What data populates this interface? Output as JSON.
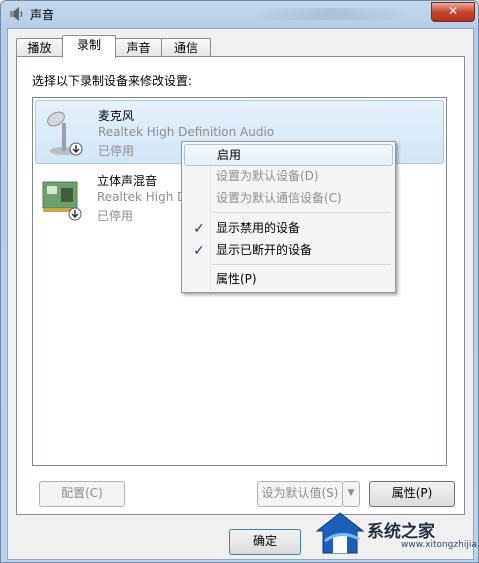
{
  "window": {
    "title": "声音",
    "close_glyph": "✕"
  },
  "tabs": [
    {
      "label": "播放"
    },
    {
      "label": "录制"
    },
    {
      "label": "声音"
    },
    {
      "label": "通信"
    }
  ],
  "prompt": "选择以下录制设备来修改设置:",
  "devices": [
    {
      "name": "麦克风",
      "driver": "Realtek High Definition Audio",
      "status": "已停用",
      "icon": "microphone-icon"
    },
    {
      "name": "立体声混音",
      "driver": "Realtek High D",
      "status": "已停用",
      "icon": "sound-card-icon"
    }
  ],
  "context_menu": {
    "items": [
      {
        "label": "启用",
        "enabled": true,
        "checked": false
      },
      {
        "label": "设置为默认设备(D)",
        "enabled": false,
        "checked": false
      },
      {
        "label": "设置为默认通信设备(C)",
        "enabled": false,
        "checked": false
      },
      {
        "label": "显示禁用的设备",
        "enabled": true,
        "checked": true
      },
      {
        "label": "显示已断开的设备",
        "enabled": true,
        "checked": true
      },
      {
        "label": "属性(P)",
        "enabled": true,
        "checked": false
      }
    ]
  },
  "buttons": {
    "configure": "配置(C)",
    "set_default": "设为默认值(S)",
    "set_default_arrow": "▼",
    "properties": "属性(P)",
    "ok": "确定"
  },
  "watermark": {
    "text": "系统之家",
    "url": "www.xitongzhijia.net"
  },
  "colors": {
    "selection": "#d1e6f8",
    "disabled_text": "#8d8d8d",
    "close_red": "#c7462f"
  }
}
